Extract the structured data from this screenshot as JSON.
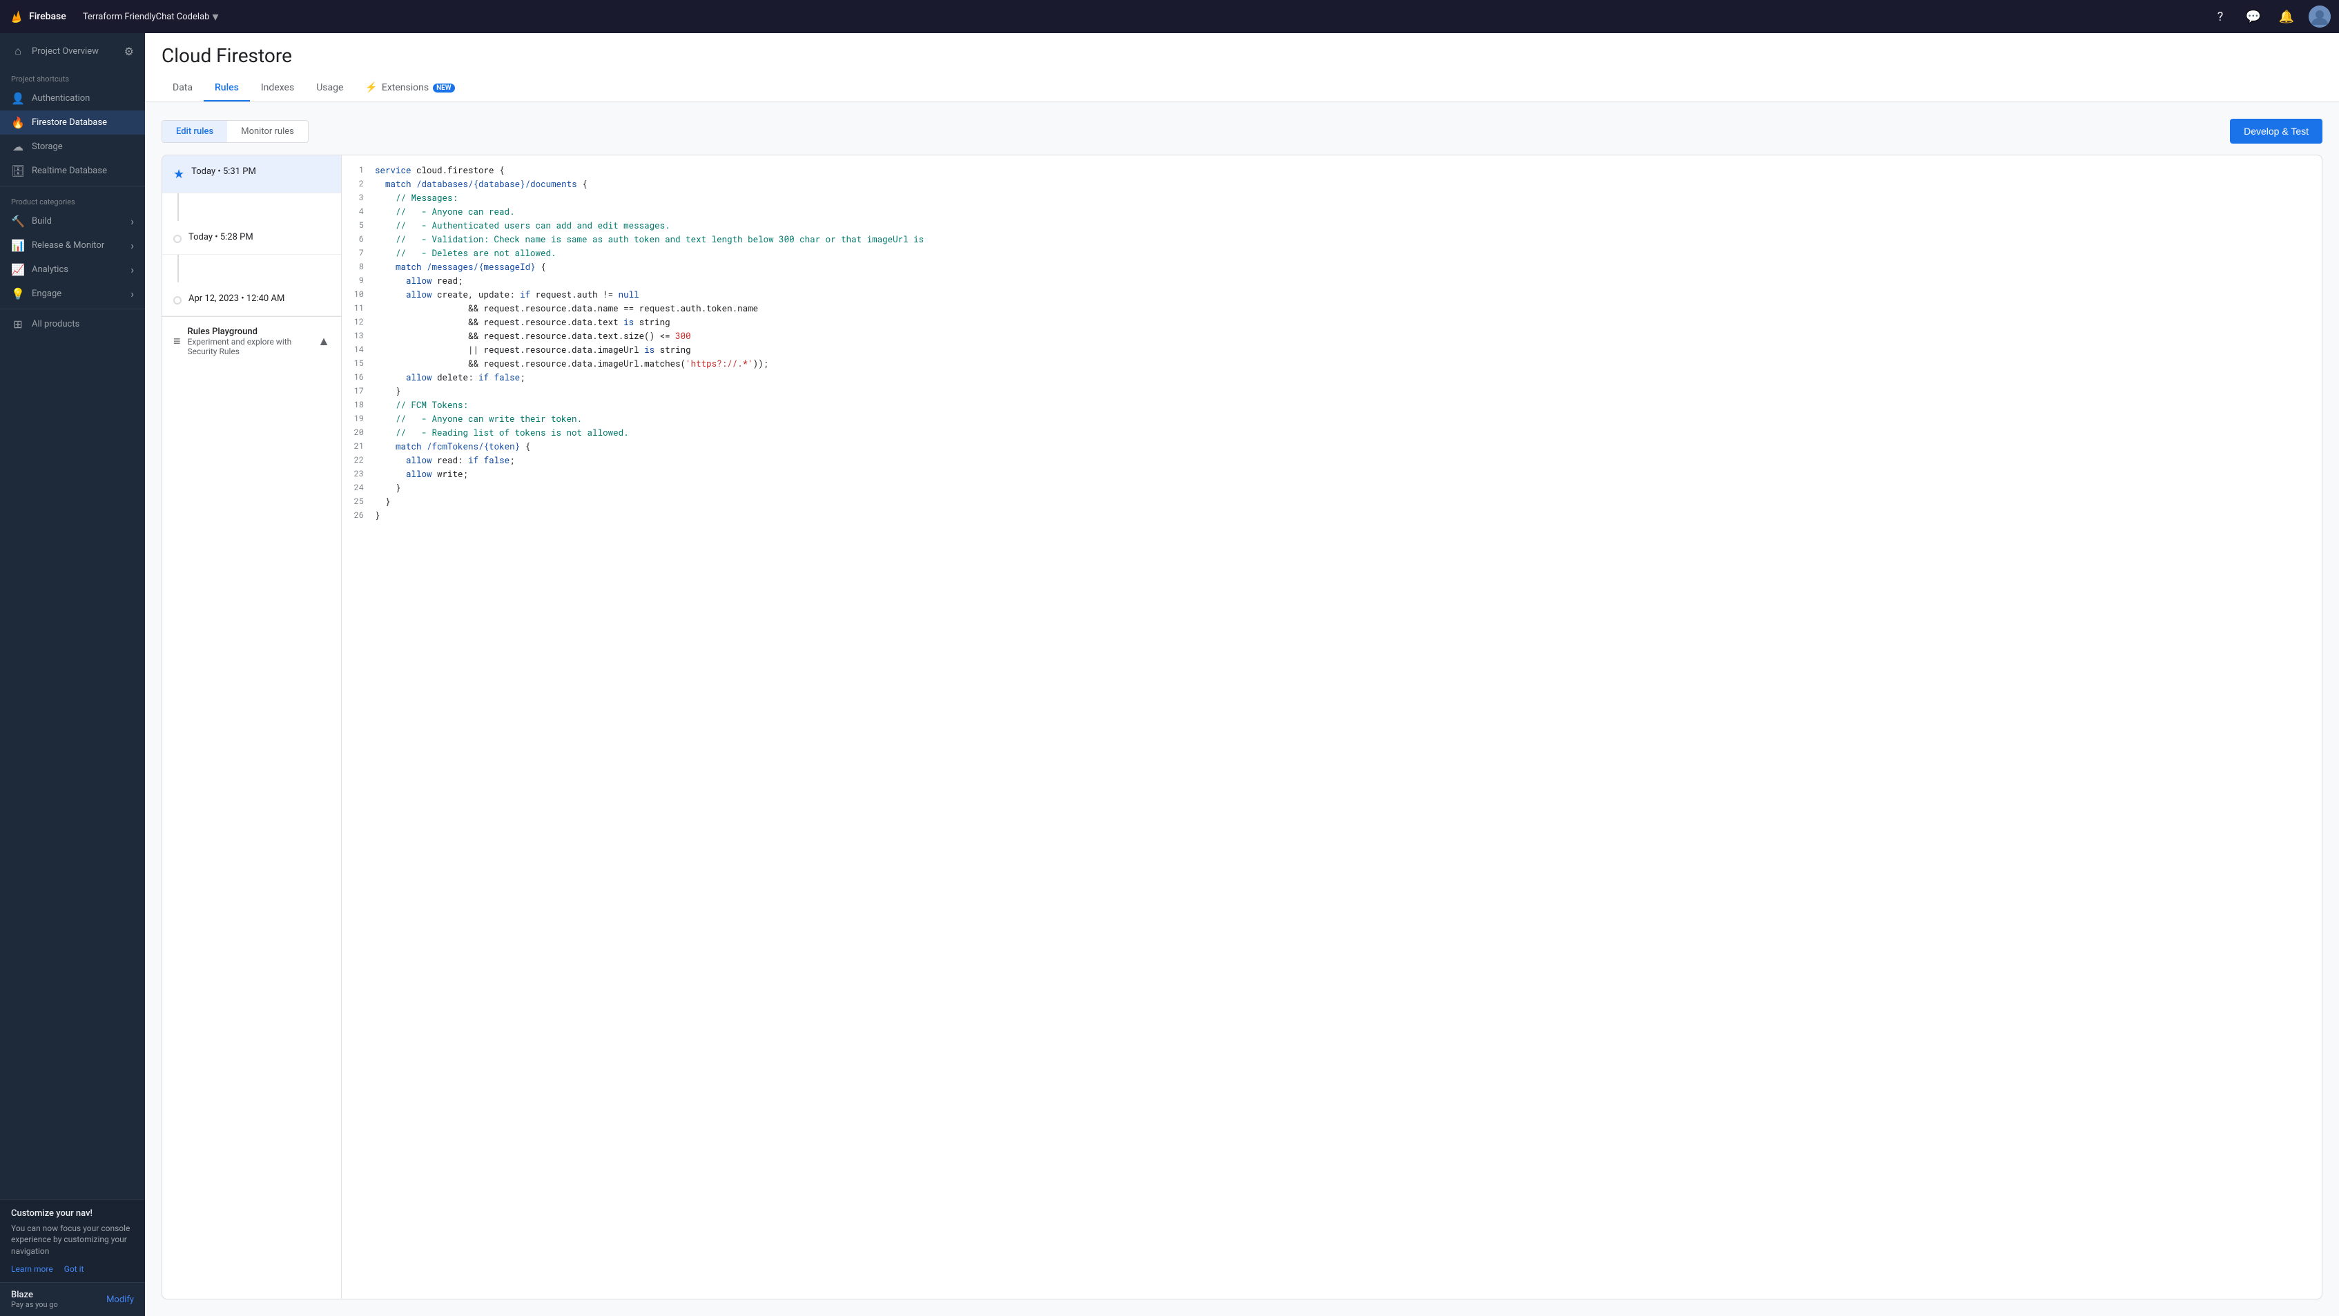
{
  "topbar": {
    "logo_text": "Firebase",
    "project_name": "Terraform FriendlyChat Codelab",
    "help_icon": "?",
    "chat_icon": "💬"
  },
  "sidebar": {
    "project_overview_label": "Project Overview",
    "section_build": "Project shortcuts",
    "items_shortcuts": [
      {
        "id": "authentication",
        "label": "Authentication",
        "icon": "🔑"
      },
      {
        "id": "firestore",
        "label": "Firestore Database",
        "icon": "🔥",
        "active": true
      },
      {
        "id": "storage",
        "label": "Storage",
        "icon": "📦"
      },
      {
        "id": "realtime-db",
        "label": "Realtime Database",
        "icon": "🗄️"
      }
    ],
    "section_product_categories": "Product categories",
    "groups": [
      {
        "id": "build",
        "label": "Build",
        "has_chevron": true
      },
      {
        "id": "release-monitor",
        "label": "Release & Monitor",
        "has_chevron": true
      },
      {
        "id": "analytics",
        "label": "Analytics",
        "has_chevron": true
      },
      {
        "id": "engage",
        "label": "Engage",
        "has_chevron": true
      }
    ],
    "all_products_label": "All products",
    "customize_nav_title": "Customize your nav!",
    "customize_nav_desc": "You can now focus your console experience by customizing your navigation",
    "learn_more_label": "Learn more",
    "got_it_label": "Got it",
    "plan_name": "Blaze",
    "plan_sub": "Pay as you go",
    "modify_label": "Modify"
  },
  "page": {
    "title": "Cloud Firestore",
    "tabs": [
      {
        "id": "data",
        "label": "Data",
        "active": false
      },
      {
        "id": "rules",
        "label": "Rules",
        "active": true
      },
      {
        "id": "indexes",
        "label": "Indexes",
        "active": false
      },
      {
        "id": "usage",
        "label": "Usage",
        "active": false
      },
      {
        "id": "extensions",
        "label": "Extensions",
        "active": false,
        "badge": "NEW",
        "icon": "⚡"
      }
    ]
  },
  "rules": {
    "tabs": [
      {
        "id": "edit-rules",
        "label": "Edit rules",
        "active": true
      },
      {
        "id": "monitor-rules",
        "label": "Monitor rules",
        "active": false
      }
    ],
    "develop_test_btn": "Develop & Test",
    "timeline": [
      {
        "id": "t1",
        "time": "Today • 5:31 PM",
        "starred": true,
        "active": true
      },
      {
        "id": "t2",
        "time": "Today • 5:28 PM",
        "starred": false
      },
      {
        "id": "t3",
        "time": "Apr 12, 2023 • 12:40 AM",
        "starred": false
      }
    ],
    "playground": {
      "title": "Rules Playground",
      "subtitle": "Experiment and explore with Security Rules",
      "chevron": "▲"
    },
    "code_lines": [
      {
        "num": 1,
        "text": "service cloud.firestore {"
      },
      {
        "num": 2,
        "text": "  match /databases/{database}/documents {"
      },
      {
        "num": 3,
        "text": "    // Messages:"
      },
      {
        "num": 4,
        "text": "    //   - Anyone can read."
      },
      {
        "num": 5,
        "text": "    //   - Authenticated users can add and edit messages."
      },
      {
        "num": 6,
        "text": "    //   - Validation: Check name is same as auth token and text length below 300 char or that imageUrl is"
      },
      {
        "num": 7,
        "text": "    //   - Deletes are not allowed."
      },
      {
        "num": 8,
        "text": "    match /messages/{messageId} {"
      },
      {
        "num": 9,
        "text": "      allow read;"
      },
      {
        "num": 10,
        "text": "      allow create, update: if request.auth != null"
      },
      {
        "num": 11,
        "text": "                  && request.resource.data.name == request.auth.token.name"
      },
      {
        "num": 12,
        "text": "                  && request.resource.data.text is string"
      },
      {
        "num": 13,
        "text": "                  && request.resource.data.text.size() <= 300"
      },
      {
        "num": 14,
        "text": "                  || request.resource.data.imageUrl is string"
      },
      {
        "num": 15,
        "text": "                  && request.resource.data.imageUrl.matches('https?://.*'));"
      },
      {
        "num": 16,
        "text": "      allow delete: if false;"
      },
      {
        "num": 17,
        "text": "    }"
      },
      {
        "num": 18,
        "text": "    // FCM Tokens:"
      },
      {
        "num": 19,
        "text": "    //   - Anyone can write their token."
      },
      {
        "num": 20,
        "text": "    //   - Reading list of tokens is not allowed."
      },
      {
        "num": 21,
        "text": "    match /fcmTokens/{token} {"
      },
      {
        "num": 22,
        "text": "      allow read: if false;"
      },
      {
        "num": 23,
        "text": "      allow write;"
      },
      {
        "num": 24,
        "text": "    }"
      },
      {
        "num": 25,
        "text": "  }"
      },
      {
        "num": 26,
        "text": "}"
      }
    ]
  }
}
